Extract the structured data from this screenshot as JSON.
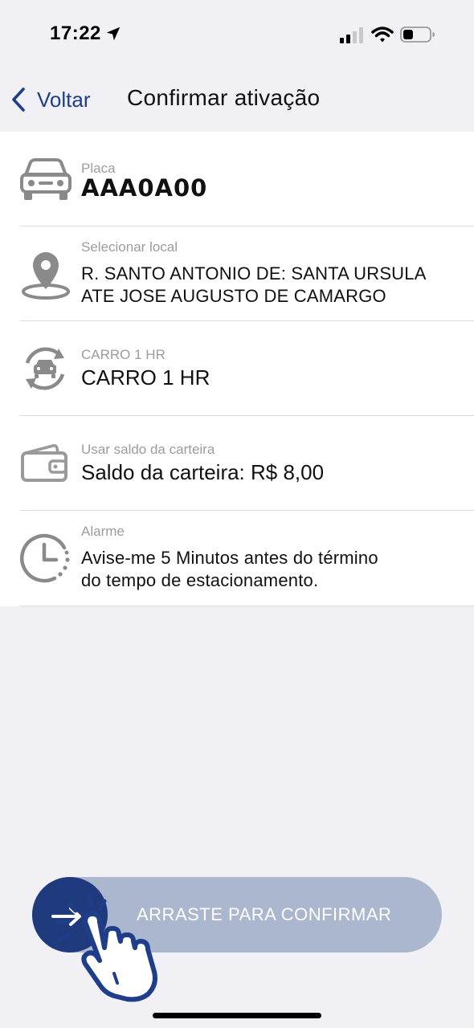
{
  "status_bar": {
    "time": "17:22",
    "icons": [
      "location-arrow-icon",
      "cellular-signal-icon",
      "wifi-icon",
      "battery-icon"
    ]
  },
  "nav": {
    "back_label": "Voltar",
    "title": "Confirmar ativação"
  },
  "rows": [
    {
      "icon": "car-icon",
      "caption": "Placa",
      "value": "AAA0A00"
    },
    {
      "icon": "map-pin-icon",
      "caption": "Selecionar local",
      "value_line1": "R. SANTO ANTONIO DE: SANTA URSULA",
      "value_line2": "ATE JOSE AUGUSTO DE CAMARGO"
    },
    {
      "icon": "car-refresh-icon",
      "caption": "CARRO 1 HR",
      "value": "CARRO 1 HR"
    },
    {
      "icon": "wallet-icon",
      "caption": "Usar saldo da carteira",
      "value": "Saldo da carteira: R$ 8,00"
    },
    {
      "icon": "alarm-clock-icon",
      "caption": "Alarme",
      "value_line1": "Avise-me 5 Minutos antes do término",
      "value_line2": "do tempo de estacionamento."
    }
  ],
  "slider": {
    "label": "ARRASTE PARA CONFIRMAR",
    "icons": [
      "arrow-right-icon",
      "tap-hand-icon"
    ]
  },
  "colors": {
    "accent": "#1f3e8a",
    "knob": "#203a7e",
    "slider_track": "#abb6cf",
    "background": "#f0f0f5",
    "icon_gray": "#8a8a8a"
  }
}
